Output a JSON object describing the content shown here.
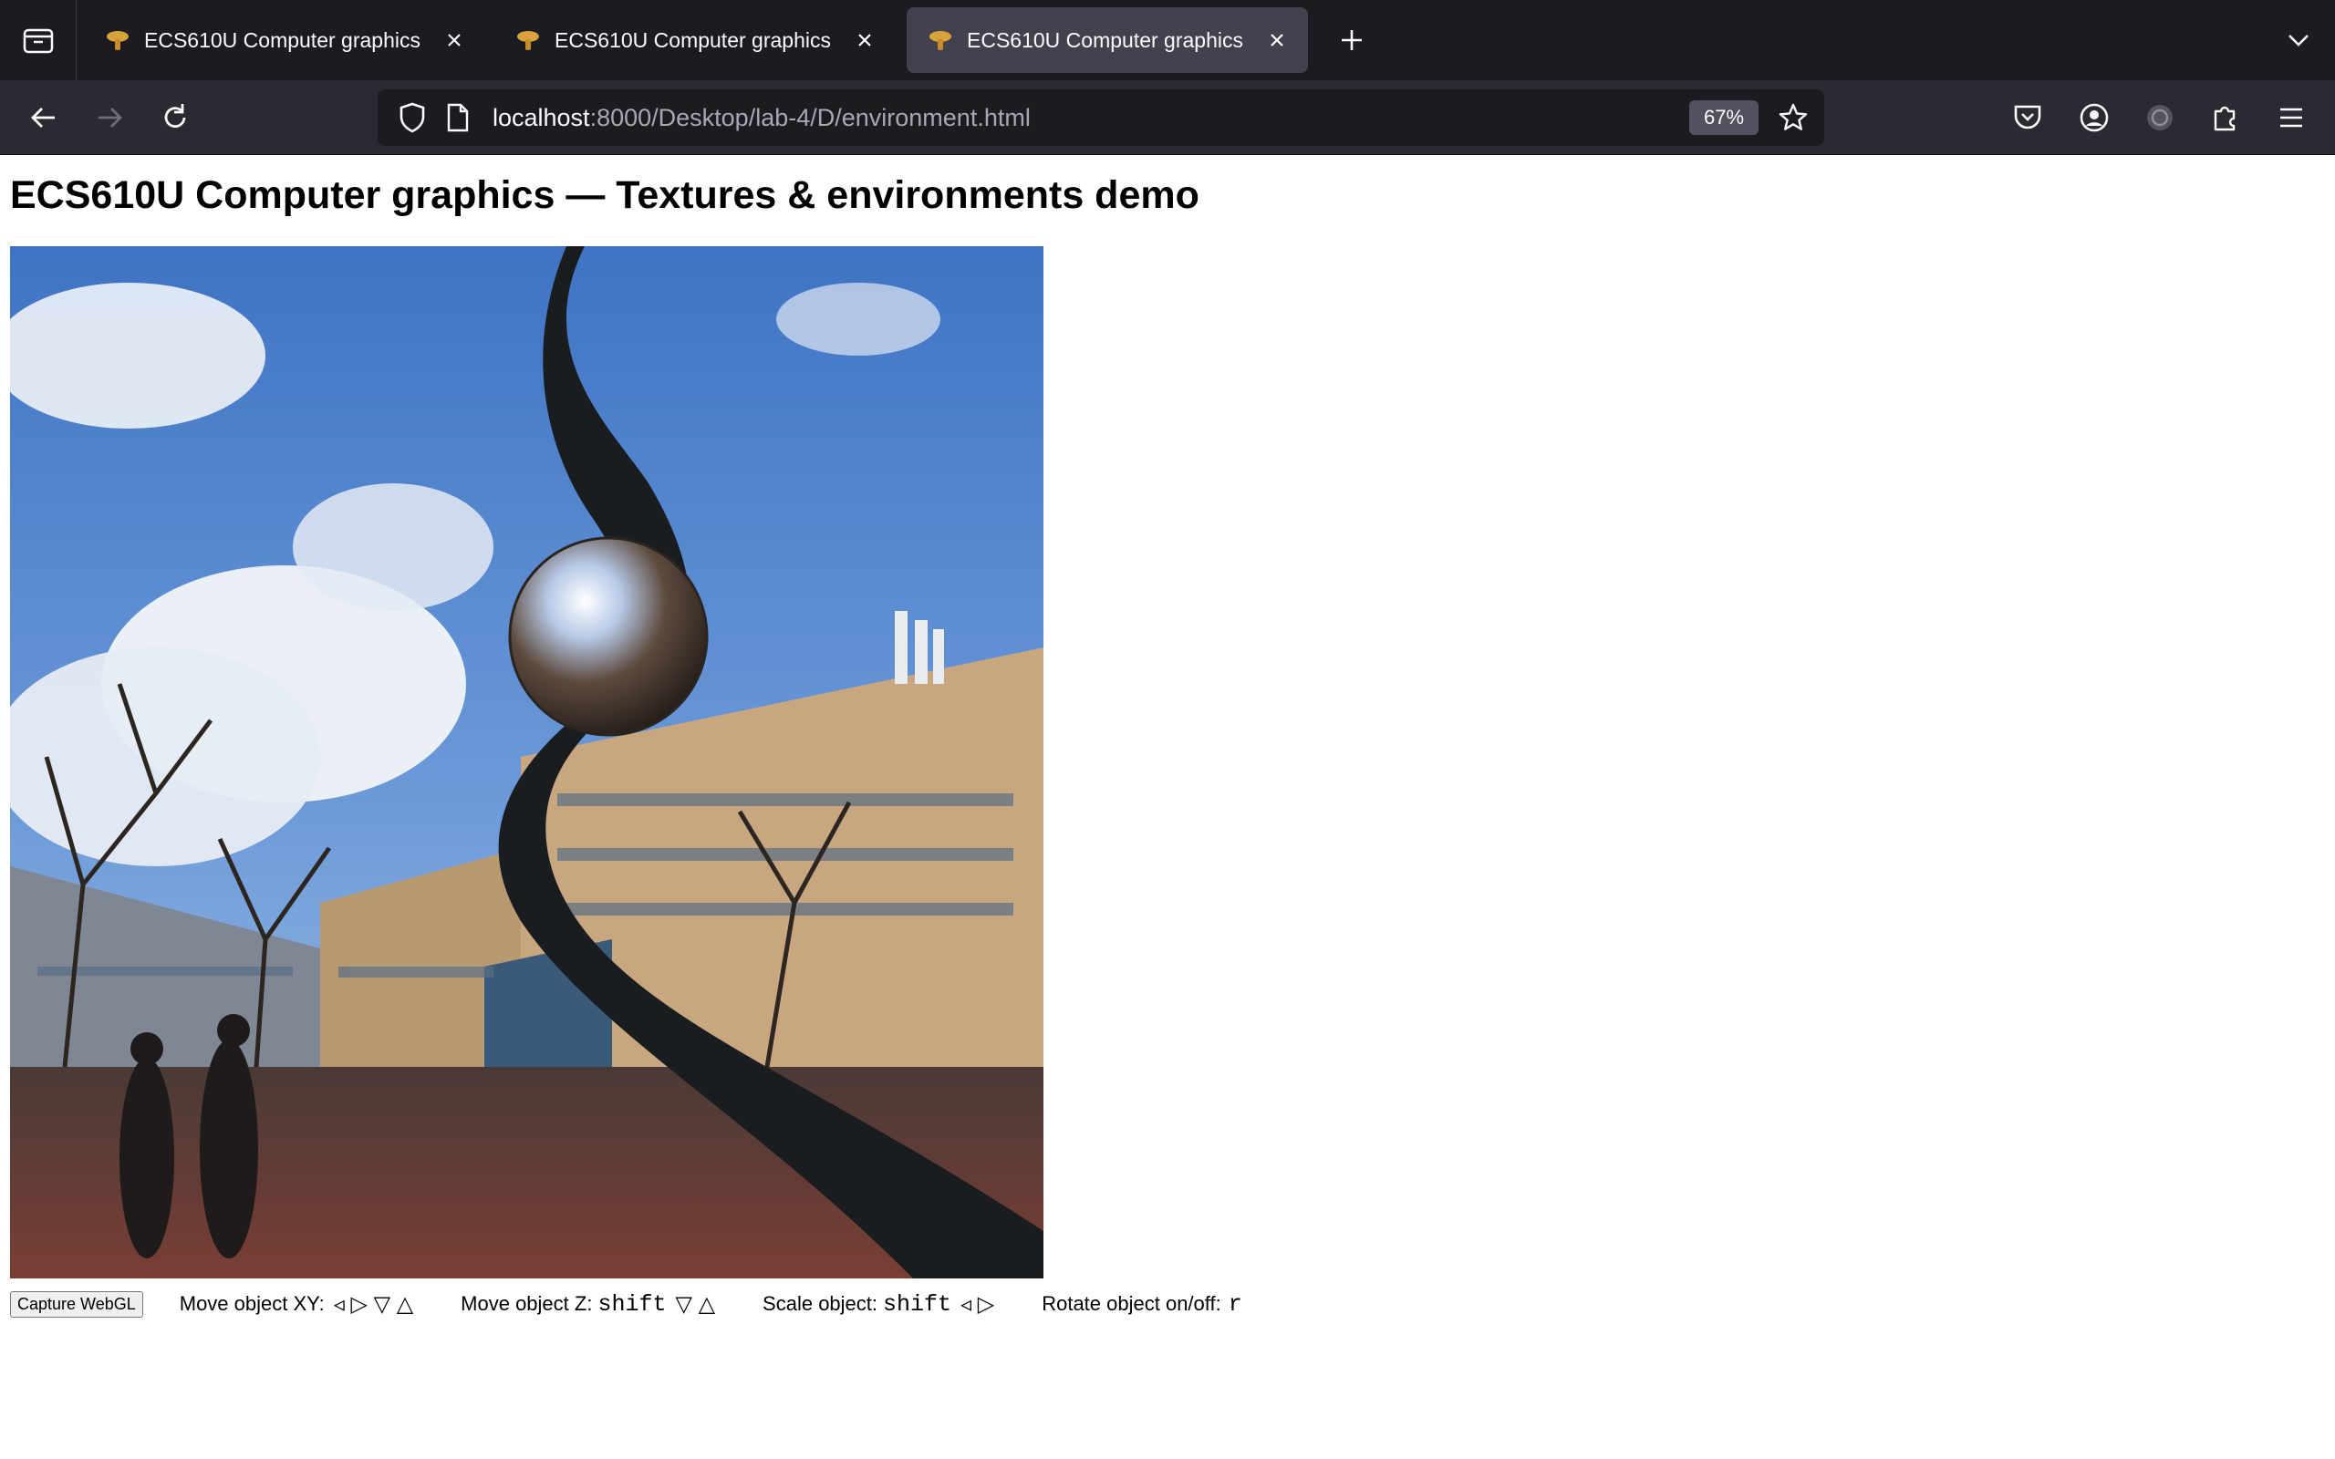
{
  "browser": {
    "tabs": [
      {
        "title": "ECS610U Computer graphics",
        "active": false
      },
      {
        "title": "ECS610U Computer graphics",
        "active": false
      },
      {
        "title": "ECS610U Computer graphics",
        "active": true
      }
    ],
    "url_host": "localhost",
    "url_path": ":8000/Desktop/lab-4/D/environment.html",
    "zoom": "67%"
  },
  "page": {
    "title": "ECS610U Computer graphics — Textures & environments demo"
  },
  "controls": {
    "capture_label": "Capture WebGL",
    "move_xy_label": "Move object XY:",
    "move_xy_keys": "◃  ▷  ▽ △",
    "move_z_label": "Move object Z:",
    "move_z_key": "shift",
    "move_z_arrows": "▽ △",
    "scale_label": "Scale object:",
    "scale_key": "shift",
    "scale_arrows": "◃  ▷",
    "rotate_label": "Rotate object on/off:",
    "rotate_key": "r"
  }
}
